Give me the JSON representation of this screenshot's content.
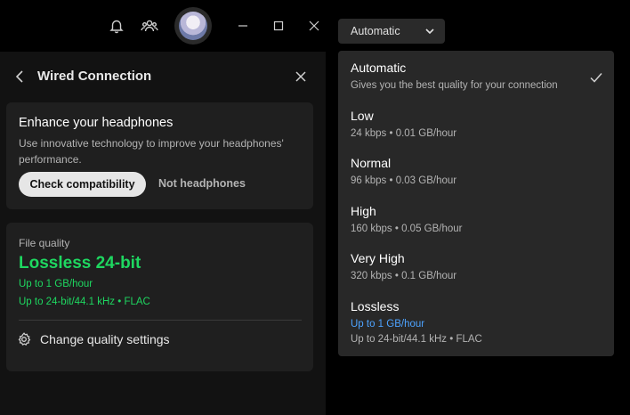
{
  "titlebar": {
    "icons": [
      "bell-icon",
      "friends-icon",
      "minimize-icon",
      "maximize-icon",
      "close-icon"
    ]
  },
  "panel": {
    "title": "Wired Connection",
    "enhance": {
      "title": "Enhance your headphones",
      "description": "Use innovative technology to improve your headphones' performance.",
      "check_button": "Check compatibility",
      "not_button": "Not headphones"
    },
    "file_quality": {
      "label": "File quality",
      "value": "Lossless 24-bit",
      "line1": "Up to 1 GB/hour",
      "line2": "Up to 24-bit/44.1 kHz • FLAC",
      "settings_link": "Change quality settings"
    }
  },
  "dropdown": {
    "selected": "Automatic",
    "options": [
      {
        "title": "Automatic",
        "subtitle": "Gives you the best quality for your connection",
        "selected": true
      },
      {
        "title": "Low",
        "subtitle": "24 kbps • 0.01 GB/hour"
      },
      {
        "title": "Normal",
        "subtitle": "96 kbps • 0.03 GB/hour"
      },
      {
        "title": "High",
        "subtitle": "160 kbps • 0.05 GB/hour"
      },
      {
        "title": "Very High",
        "subtitle": "320 kbps • 0.1 GB/hour"
      },
      {
        "title": "Lossless",
        "subtitle": "Up to 1 GB/hour",
        "subtitle2": "Up to 24-bit/44.1 kHz • FLAC"
      }
    ]
  },
  "colors": {
    "accent_green": "#1ed760",
    "link_blue": "#4da3ff",
    "panel_bg": "#121212",
    "card_bg": "#1f1f1f",
    "menu_bg": "#282828"
  }
}
